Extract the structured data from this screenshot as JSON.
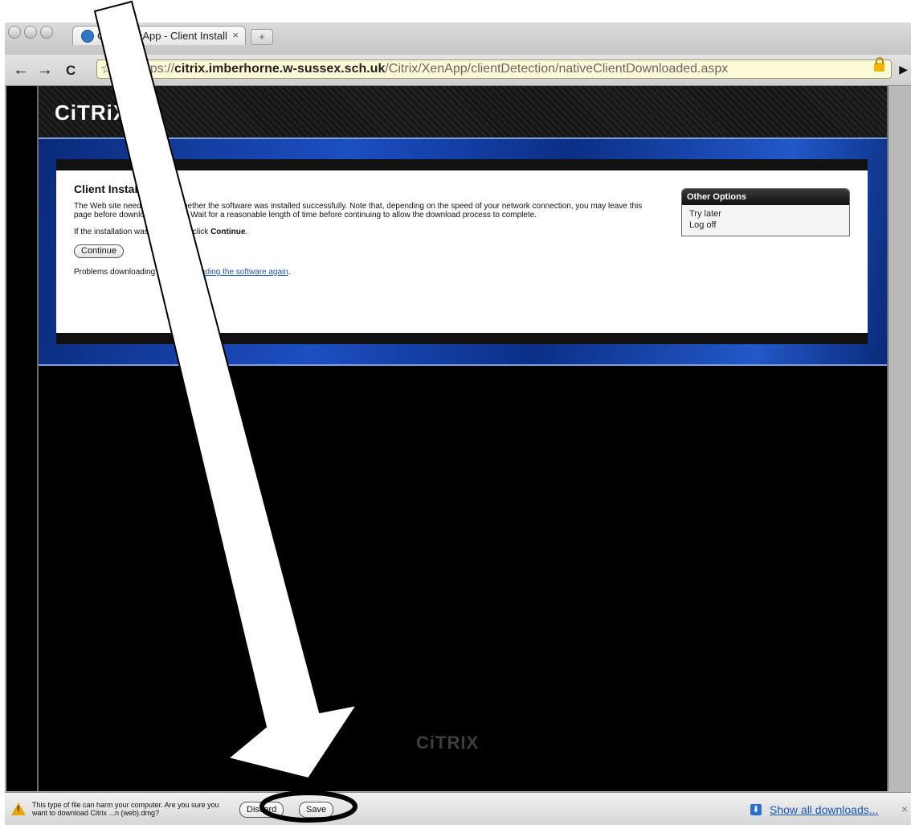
{
  "browser": {
    "tab_title": "Citrix XenApp - Client Install",
    "tab_close": "×",
    "new_tab": "+",
    "url_prefix": "https://",
    "url_host": "citrix.imberhorne.w-sussex.sch.uk",
    "url_path": "/Citrix/XenApp/clientDetection/nativeClientDownloaded.aspx",
    "back": "←",
    "forward": "→",
    "reload": "C",
    "star": "☆",
    "page_menu": "▶"
  },
  "site": {
    "logo": "CiTRiX",
    "footer_logo": "CiTRIX"
  },
  "panel": {
    "title": "Client Installation",
    "body": "The Web site needs to know whether the software was installed successfully. Note that, depending on the speed of your network connection, you may leave this page before downloading starts. Wait for a reasonable length of time before continuing to allow the download process to complete.",
    "if_text": "If the installation was successful, click ",
    "if_bold": "Continue",
    "if_end": ".",
    "continue_button": "Continue",
    "problems_text": "Problems downloading? Try ",
    "problems_link": "downloading the software again",
    "problems_end": "."
  },
  "other_options": {
    "title": "Other Options",
    "items": [
      "Try later",
      "Log off"
    ]
  },
  "download_bar": {
    "message": "This type of file can harm your computer. Are you sure you want to download Citrix ...n (web).dmg?",
    "discard": "Discard",
    "save": "Save",
    "show_all": "Show all downloads...",
    "close": "×"
  },
  "colors": {
    "banner_blue": "#1c4fc2",
    "link_blue": "#1a57b8",
    "omnibox_yellow": "#fdfbd7",
    "warning_orange": "#e8a400"
  }
}
